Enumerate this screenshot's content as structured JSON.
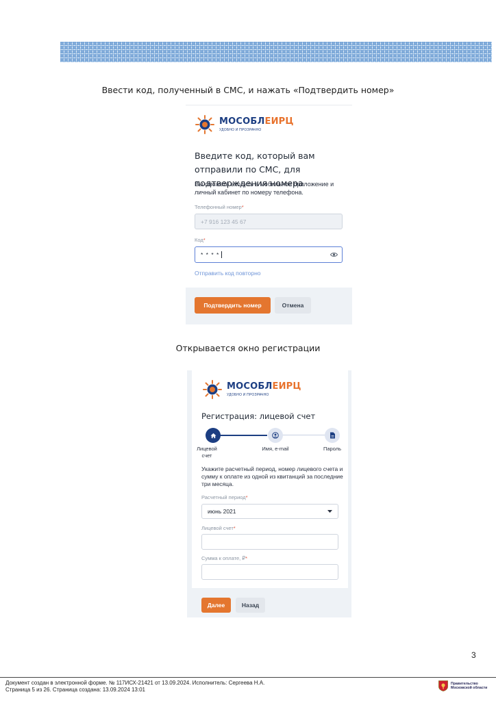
{
  "captions": {
    "top": "Ввести код, полученный в СМС, и нажать «Подтвердить номер»",
    "middle": "Открывается окно регистрации"
  },
  "brand": {
    "name_prefix": "МОСОБЛ",
    "name_suffix": "ЕИРЦ",
    "tagline": "УДОБНО И ПРОЗРАЧНО",
    "primary_color": "#1c3e82",
    "accent_color": "#e4762f"
  },
  "sms_form": {
    "title": "Введите код, который вам отправили по СМС, для подтверждения номера",
    "description": "Вы сможете входить в мобильное приложение и личный кабинет по номеру телефона.",
    "phone_label": "Телефонный номер",
    "phone_value": "+7 916 123 45 67",
    "code_label": "Код",
    "code_value": "* * * *",
    "resend_link": "Отправить код повторно",
    "confirm_button": "Подтвердить номер",
    "cancel_button": "Отмена"
  },
  "registration_form": {
    "title": "Регистрация: лицевой счет",
    "steps": [
      {
        "label": "Лицевой счет",
        "icon": "home-icon",
        "state": "active"
      },
      {
        "label": "Имя, e-mail",
        "icon": "user-icon",
        "state": "inactive"
      },
      {
        "label": "Пароль",
        "icon": "document-icon",
        "state": "inactive"
      }
    ],
    "description": "Укажите расчетный период, номер лицевого счета и сумму к оплате из одной из квитанций за последние три месяца.",
    "period_label": "Расчетный период",
    "period_value": "июнь 2021",
    "account_label": "Лицевой счет",
    "account_value": "",
    "amount_label": "Сумма к оплате, ₽",
    "amount_value": "",
    "next_button": "Далее",
    "back_button": "Назад"
  },
  "page": {
    "number": "3",
    "footer_line1": "Документ создан в электронной форме. № 117ИСХ-21421 от 13.09.2024. Исполнитель: Сергеева Н.А.",
    "footer_line2": "Страница 5 из 26. Страница создана: 13.09.2024 13:01",
    "gov_line1": "Правительство",
    "gov_line2": "Московской области"
  }
}
